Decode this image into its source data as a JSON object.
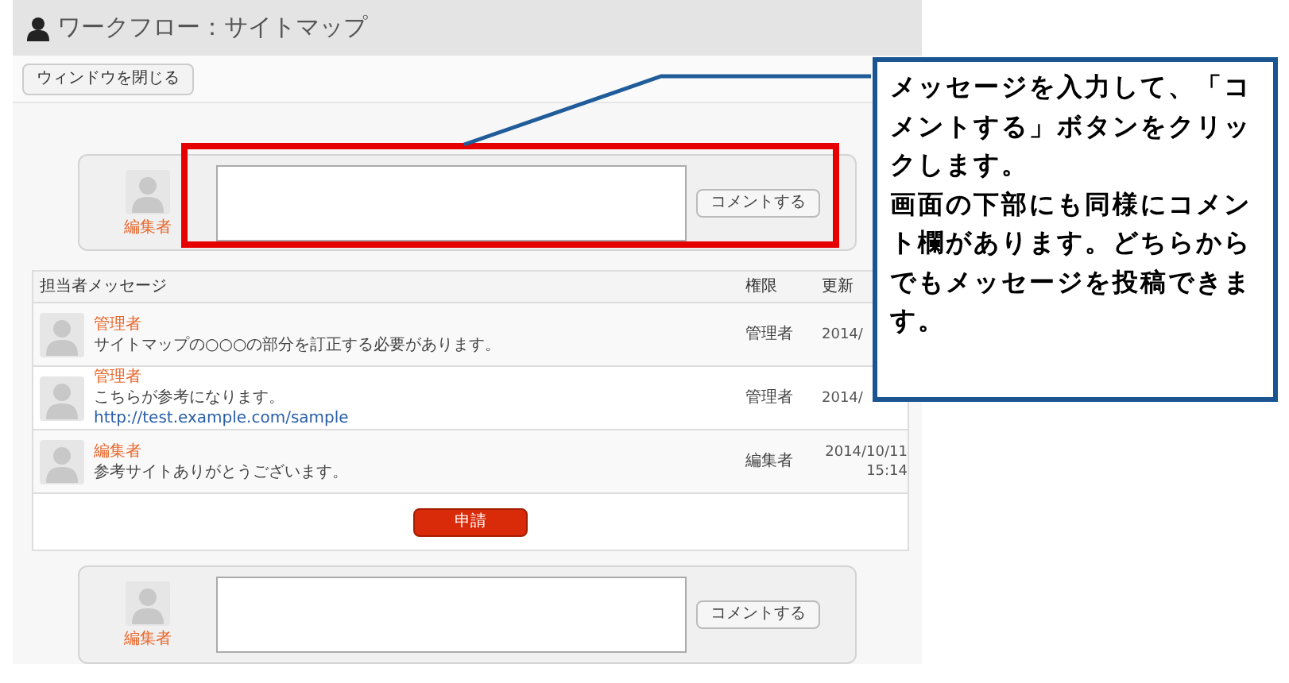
{
  "window": {
    "title": "ワークフロー：サイトマップ"
  },
  "toolbar": {
    "close_button": "ウィンドウを閉じる"
  },
  "comment_forms": [
    {
      "user": "編集者",
      "button": "コメントする",
      "highlighted": true
    },
    {
      "user": "編集者",
      "button": "コメントする",
      "highlighted": false
    }
  ],
  "messages": {
    "columns": [
      "担当者メッセージ",
      "権限",
      "更新"
    ],
    "rows": [
      {
        "author": "管理者",
        "text": "サイトマップの○○○の部分を訂正する必要があります。",
        "role": "管理者",
        "updated": [
          "2014/"
        ]
      },
      {
        "author": "管理者",
        "text": "こちらが参考になります。",
        "link": "http://test.example.com/sample",
        "role": "管理者",
        "updated": [
          "2014/"
        ]
      },
      {
        "author": "編集者",
        "text": "参考サイトありがとうございます。",
        "role": "編集者",
        "updated": [
          "2014/10/11",
          "15:14"
        ]
      }
    ]
  },
  "submit_button": "申請",
  "callout": {
    "paragraphs": [
      "メッセージを入力して、「コメントする」ボタンをクリックします。",
      "画面の下部にも同様にコメント欄があります。どちらからでもメッセージを投稿できます。"
    ]
  }
}
